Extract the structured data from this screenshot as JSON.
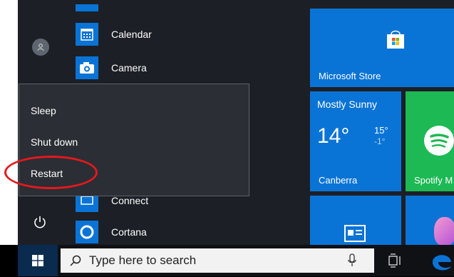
{
  "apps": {
    "calendar": "Calendar",
    "camera": "Camera",
    "connect": "Connect",
    "cortana": "Cortana"
  },
  "tiles": {
    "store": "Microsoft Store",
    "weather": {
      "condition": "Mostly Sunny",
      "temp": "14°",
      "high": "15°",
      "low": "-1°",
      "city": "Canberra"
    },
    "spotify": "Spotify M"
  },
  "power_menu": {
    "sleep": "Sleep",
    "shutdown": "Shut down",
    "restart": "Restart"
  },
  "taskbar": {
    "search_placeholder": "Type here to search"
  },
  "colors": {
    "accent": "#0a74d6",
    "highlight_circle": "#e3191e",
    "spotify": "#1db954"
  }
}
